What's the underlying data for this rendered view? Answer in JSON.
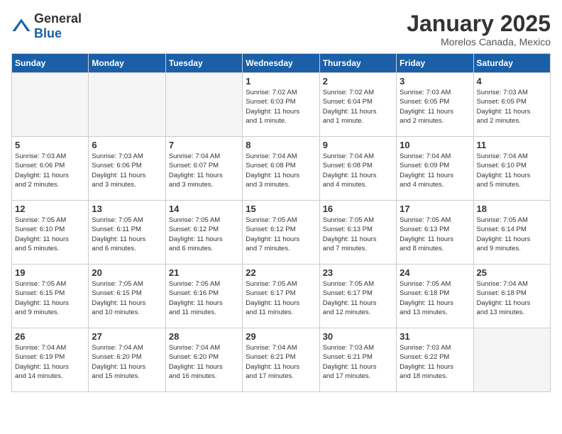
{
  "header": {
    "logo_general": "General",
    "logo_blue": "Blue",
    "calendar_title": "January 2025",
    "calendar_subtitle": "Morelos Canada, Mexico"
  },
  "weekdays": [
    "Sunday",
    "Monday",
    "Tuesday",
    "Wednesday",
    "Thursday",
    "Friday",
    "Saturday"
  ],
  "weeks": [
    [
      {
        "day": "",
        "info": ""
      },
      {
        "day": "",
        "info": ""
      },
      {
        "day": "",
        "info": ""
      },
      {
        "day": "1",
        "info": "Sunrise: 7:02 AM\nSunset: 6:03 PM\nDaylight: 11 hours\nand 1 minute."
      },
      {
        "day": "2",
        "info": "Sunrise: 7:02 AM\nSunset: 6:04 PM\nDaylight: 11 hours\nand 1 minute."
      },
      {
        "day": "3",
        "info": "Sunrise: 7:03 AM\nSunset: 6:05 PM\nDaylight: 11 hours\nand 2 minutes."
      },
      {
        "day": "4",
        "info": "Sunrise: 7:03 AM\nSunset: 6:05 PM\nDaylight: 11 hours\nand 2 minutes."
      }
    ],
    [
      {
        "day": "5",
        "info": "Sunrise: 7:03 AM\nSunset: 6:06 PM\nDaylight: 11 hours\nand 2 minutes."
      },
      {
        "day": "6",
        "info": "Sunrise: 7:03 AM\nSunset: 6:06 PM\nDaylight: 11 hours\nand 3 minutes."
      },
      {
        "day": "7",
        "info": "Sunrise: 7:04 AM\nSunset: 6:07 PM\nDaylight: 11 hours\nand 3 minutes."
      },
      {
        "day": "8",
        "info": "Sunrise: 7:04 AM\nSunset: 6:08 PM\nDaylight: 11 hours\nand 3 minutes."
      },
      {
        "day": "9",
        "info": "Sunrise: 7:04 AM\nSunset: 6:08 PM\nDaylight: 11 hours\nand 4 minutes."
      },
      {
        "day": "10",
        "info": "Sunrise: 7:04 AM\nSunset: 6:09 PM\nDaylight: 11 hours\nand 4 minutes."
      },
      {
        "day": "11",
        "info": "Sunrise: 7:04 AM\nSunset: 6:10 PM\nDaylight: 11 hours\nand 5 minutes."
      }
    ],
    [
      {
        "day": "12",
        "info": "Sunrise: 7:05 AM\nSunset: 6:10 PM\nDaylight: 11 hours\nand 5 minutes."
      },
      {
        "day": "13",
        "info": "Sunrise: 7:05 AM\nSunset: 6:11 PM\nDaylight: 11 hours\nand 6 minutes."
      },
      {
        "day": "14",
        "info": "Sunrise: 7:05 AM\nSunset: 6:12 PM\nDaylight: 11 hours\nand 6 minutes."
      },
      {
        "day": "15",
        "info": "Sunrise: 7:05 AM\nSunset: 6:12 PM\nDaylight: 11 hours\nand 7 minutes."
      },
      {
        "day": "16",
        "info": "Sunrise: 7:05 AM\nSunset: 6:13 PM\nDaylight: 11 hours\nand 7 minutes."
      },
      {
        "day": "17",
        "info": "Sunrise: 7:05 AM\nSunset: 6:13 PM\nDaylight: 11 hours\nand 8 minutes."
      },
      {
        "day": "18",
        "info": "Sunrise: 7:05 AM\nSunset: 6:14 PM\nDaylight: 11 hours\nand 9 minutes."
      }
    ],
    [
      {
        "day": "19",
        "info": "Sunrise: 7:05 AM\nSunset: 6:15 PM\nDaylight: 11 hours\nand 9 minutes."
      },
      {
        "day": "20",
        "info": "Sunrise: 7:05 AM\nSunset: 6:15 PM\nDaylight: 11 hours\nand 10 minutes."
      },
      {
        "day": "21",
        "info": "Sunrise: 7:05 AM\nSunset: 6:16 PM\nDaylight: 11 hours\nand 11 minutes."
      },
      {
        "day": "22",
        "info": "Sunrise: 7:05 AM\nSunset: 6:17 PM\nDaylight: 11 hours\nand 11 minutes."
      },
      {
        "day": "23",
        "info": "Sunrise: 7:05 AM\nSunset: 6:17 PM\nDaylight: 11 hours\nand 12 minutes."
      },
      {
        "day": "24",
        "info": "Sunrise: 7:05 AM\nSunset: 6:18 PM\nDaylight: 11 hours\nand 13 minutes."
      },
      {
        "day": "25",
        "info": "Sunrise: 7:04 AM\nSunset: 6:18 PM\nDaylight: 11 hours\nand 13 minutes."
      }
    ],
    [
      {
        "day": "26",
        "info": "Sunrise: 7:04 AM\nSunset: 6:19 PM\nDaylight: 11 hours\nand 14 minutes."
      },
      {
        "day": "27",
        "info": "Sunrise: 7:04 AM\nSunset: 6:20 PM\nDaylight: 11 hours\nand 15 minutes."
      },
      {
        "day": "28",
        "info": "Sunrise: 7:04 AM\nSunset: 6:20 PM\nDaylight: 11 hours\nand 16 minutes."
      },
      {
        "day": "29",
        "info": "Sunrise: 7:04 AM\nSunset: 6:21 PM\nDaylight: 11 hours\nand 17 minutes."
      },
      {
        "day": "30",
        "info": "Sunrise: 7:03 AM\nSunset: 6:21 PM\nDaylight: 11 hours\nand 17 minutes."
      },
      {
        "day": "31",
        "info": "Sunrise: 7:03 AM\nSunset: 6:22 PM\nDaylight: 11 hours\nand 18 minutes."
      },
      {
        "day": "",
        "info": ""
      }
    ]
  ]
}
